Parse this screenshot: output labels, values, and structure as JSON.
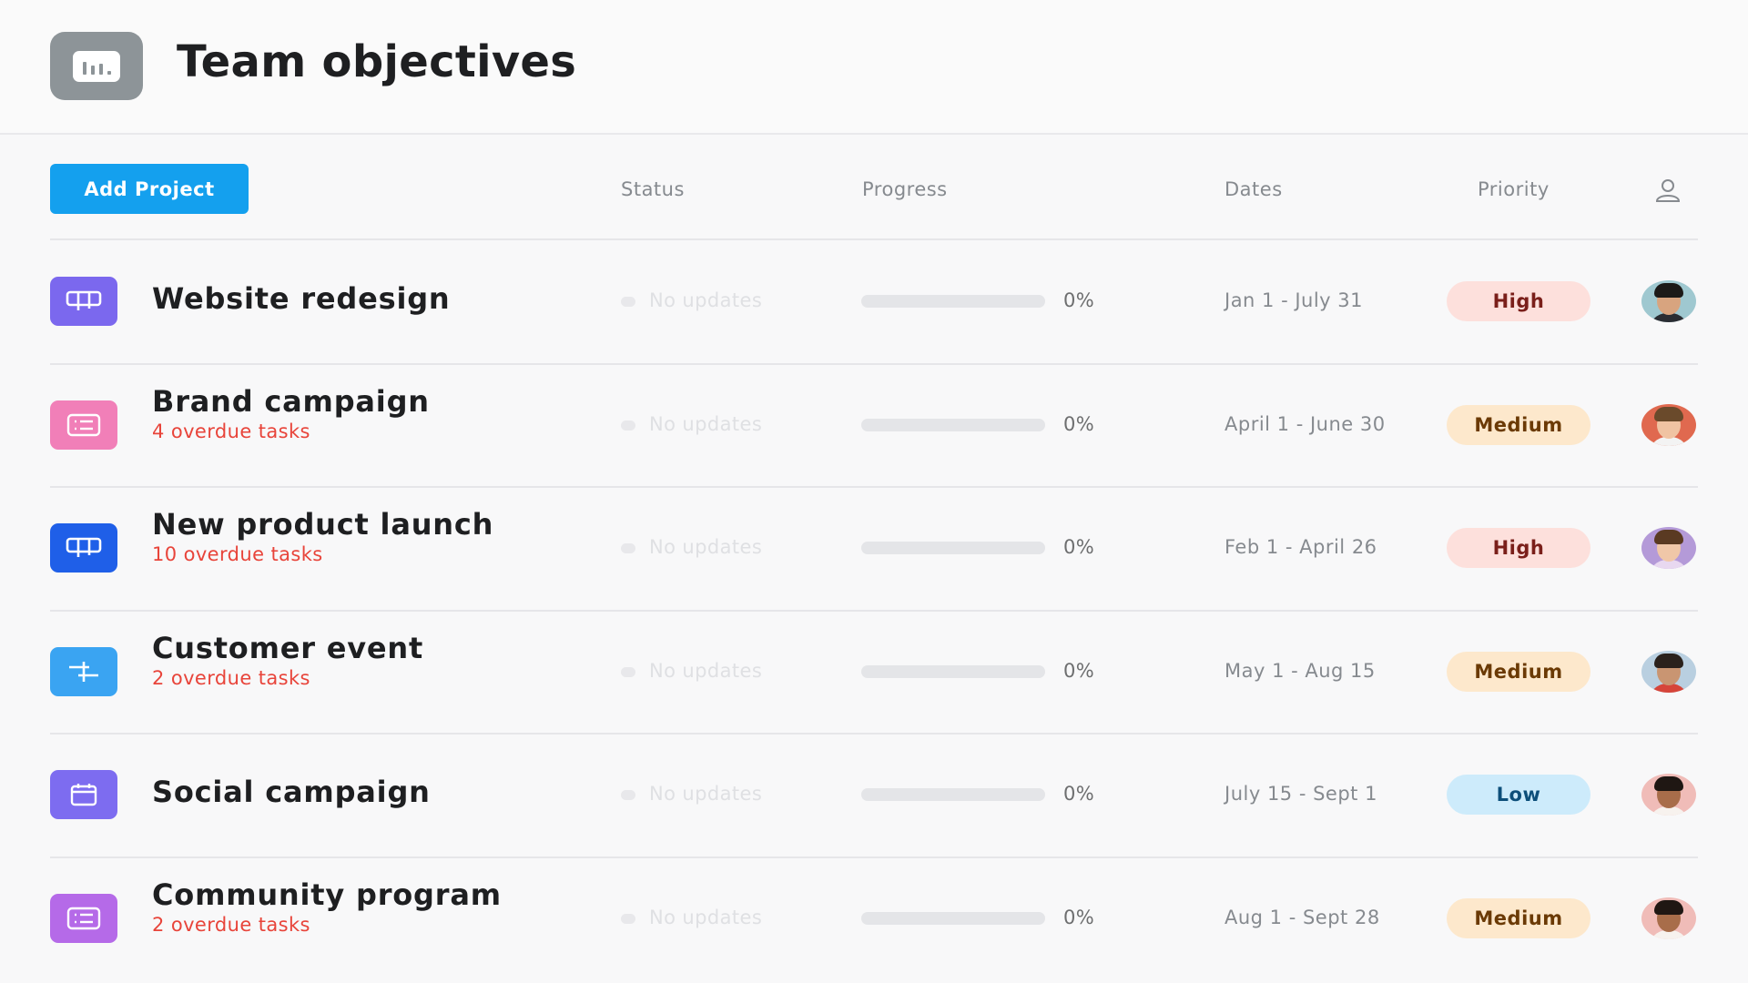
{
  "header": {
    "title": "Team objectives",
    "icon": "bar-chart-icon"
  },
  "toolbar": {
    "add_project_label": "Add Project",
    "columns": {
      "status": "Status",
      "progress": "Progress",
      "dates": "Dates",
      "priority": "Priority",
      "assignee_icon": "person-icon"
    }
  },
  "colors": {
    "accent": "#14a0ee",
    "overdue": "#e8443a",
    "priority_high_bg": "#fde0dc",
    "priority_high_text": "#7a1f1a",
    "priority_medium_bg": "#fde8cc",
    "priority_medium_text": "#6b3a05",
    "priority_low_bg": "#cdebfb",
    "priority_low_text": "#0d4f7a"
  },
  "projects": [
    {
      "name": "Website redesign",
      "overdue": "",
      "icon": "board-icon",
      "icon_color": "#7b68ee",
      "status": "No updates",
      "progress": 0,
      "progress_label": "0%",
      "dates": "Jan 1 - July 31",
      "priority": "High"
    },
    {
      "name": "Brand campaign",
      "overdue": "4 overdue tasks",
      "icon": "list-icon",
      "icon_color": "#f17fb8",
      "status": "No updates",
      "progress": 0,
      "progress_label": "0%",
      "dates": "April 1 - June 30",
      "priority": "Medium"
    },
    {
      "name": "New product launch",
      "overdue": "10 overdue tasks",
      "icon": "board-icon",
      "icon_color": "#1f5fe8",
      "status": "No updates",
      "progress": 0,
      "progress_label": "0%",
      "dates": "Feb 1 - April 26",
      "priority": "High"
    },
    {
      "name": "Customer event",
      "overdue": "2 overdue tasks",
      "icon": "timeline-icon",
      "icon_color": "#3aa4f2",
      "status": "No updates",
      "progress": 0,
      "progress_label": "0%",
      "dates": "May 1 - Aug 15",
      "priority": "Medium"
    },
    {
      "name": "Social campaign",
      "overdue": "",
      "icon": "calendar-icon",
      "icon_color": "#7d6cf0",
      "status": "No updates",
      "progress": 0,
      "progress_label": "0%",
      "dates": "July 15 - Sept 1",
      "priority": "Low"
    },
    {
      "name": "Community program",
      "overdue": "2 overdue tasks",
      "icon": "list-icon",
      "icon_color": "#b56ae8",
      "status": "No updates",
      "progress": 0,
      "progress_label": "0%",
      "dates": "Aug 1 - Sept 28",
      "priority": "Medium"
    }
  ]
}
